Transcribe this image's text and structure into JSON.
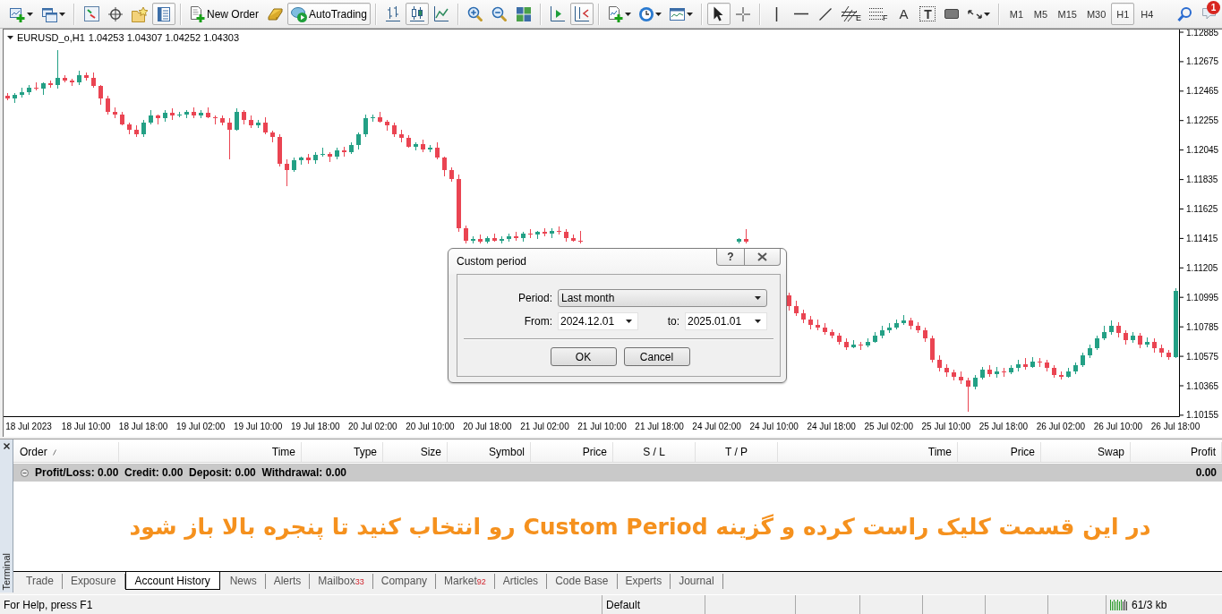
{
  "toolbar": [
    {
      "kind": "new-chart",
      "dropdown": true,
      "pressed": false
    },
    {
      "kind": "profiles",
      "dropdown": true,
      "pressed": false
    },
    {
      "kind": "separator"
    },
    {
      "kind": "market-watch",
      "pressed": false
    },
    {
      "kind": "data-window",
      "pressed": false
    },
    {
      "kind": "navigator",
      "pressed": false
    },
    {
      "kind": "terminal",
      "pressed": true
    },
    {
      "kind": "separator"
    },
    {
      "kind": "new-order",
      "label": "New Order",
      "pressed": false
    },
    {
      "kind": "editor",
      "pressed": false
    },
    {
      "kind": "autotrading",
      "label": "AutoTrading",
      "pressed": true
    },
    {
      "kind": "separator"
    },
    {
      "kind": "bars",
      "pressed": false
    },
    {
      "kind": "candles",
      "pressed": true
    },
    {
      "kind": "line",
      "pressed": false
    },
    {
      "kind": "separator"
    },
    {
      "kind": "zoom-in",
      "pressed": false
    },
    {
      "kind": "zoom-out",
      "pressed": false
    },
    {
      "kind": "tile",
      "pressed": false
    },
    {
      "kind": "separator"
    },
    {
      "kind": "chart-shift",
      "pressed": false
    },
    {
      "kind": "autoscroll",
      "pressed": true
    },
    {
      "kind": "separator"
    },
    {
      "kind": "indicators",
      "dropdown": true,
      "pressed": false
    },
    {
      "kind": "periods",
      "dropdown": true,
      "pressed": false
    },
    {
      "kind": "templates",
      "dropdown": true,
      "pressed": false
    },
    {
      "kind": "separator"
    },
    {
      "kind": "cursor",
      "pressed": true
    },
    {
      "kind": "crosshair",
      "pressed": false
    },
    {
      "kind": "separator"
    },
    {
      "kind": "vline",
      "pressed": false
    },
    {
      "kind": "hline",
      "pressed": false
    },
    {
      "kind": "trendline",
      "pressed": false
    },
    {
      "kind": "fibo-channel",
      "glyph": "E",
      "pressed": false
    },
    {
      "kind": "fibo-levels",
      "glyph": "F",
      "pressed": false
    },
    {
      "kind": "text-tool",
      "glyph": "A",
      "pressed": false
    },
    {
      "kind": "text-label",
      "glyph": "T",
      "pressed": false
    },
    {
      "kind": "rectangle",
      "pressed": false
    },
    {
      "kind": "arrows",
      "dropdown": true,
      "pressed": false
    },
    {
      "kind": "separator"
    },
    {
      "kind": "timeframe",
      "label": "M1",
      "pressed": false
    },
    {
      "kind": "timeframe",
      "label": "M5",
      "pressed": false
    },
    {
      "kind": "timeframe",
      "label": "M15",
      "pressed": false
    },
    {
      "kind": "timeframe",
      "label": "M30",
      "pressed": false
    },
    {
      "kind": "timeframe",
      "label": "H1",
      "pressed": true
    },
    {
      "kind": "timeframe",
      "label": "H4",
      "pressed": false
    },
    {
      "kind": "search",
      "pressed": false
    },
    {
      "kind": "chat",
      "badge": "1",
      "pressed": false
    }
  ],
  "chart": {
    "symbol": "EURUSD_o,H1",
    "quote": "1.04253 1.04307 1.04252 1.04303",
    "chart_data": {
      "type": "candlestick",
      "ylim": [
        1.10148,
        1.12904
      ],
      "yticks": [
        1.12885,
        1.12675,
        1.12465,
        1.12255,
        1.12045,
        1.11835,
        1.11625,
        1.11415,
        1.11205,
        1.10995,
        1.10785,
        1.10575,
        1.10365,
        1.10155
      ],
      "categories": [
        null,
        null,
        null,
        "18 Jul 2023",
        null,
        null,
        null,
        null,
        null,
        null,
        null,
        "18 Jul 10:00",
        null,
        null,
        null,
        null,
        null,
        null,
        null,
        "18 Jul 18:00",
        null,
        null,
        null,
        null,
        null,
        null,
        null,
        "19 Jul 02:00",
        null,
        null,
        null,
        null,
        null,
        null,
        null,
        "19 Jul 10:00",
        null,
        null,
        null,
        null,
        null,
        null,
        null,
        "19 Jul 18:00",
        null,
        null,
        null,
        null,
        null,
        null,
        null,
        "20 Jul 02:00",
        null,
        null,
        null,
        null,
        null,
        null,
        null,
        "20 Jul 10:00",
        null,
        null,
        null,
        null,
        null,
        null,
        null,
        "20 Jul 18:00",
        null,
        null,
        null,
        null,
        null,
        null,
        null,
        "21 Jul 02:00",
        null,
        null,
        null,
        null,
        null,
        null,
        null,
        "21 Jul 10:00",
        null,
        null,
        null,
        null,
        null,
        null,
        null,
        "21 Jul 18:00",
        null,
        null,
        null,
        null,
        null,
        null,
        null,
        "24 Jul 02:00",
        null,
        null,
        null,
        null,
        null,
        null,
        null,
        "24 Jul 10:00",
        null,
        null,
        null,
        null,
        null,
        null,
        null,
        "24 Jul 18:00",
        null,
        null,
        null,
        null,
        null,
        null,
        null,
        "25 Jul 02:00",
        null,
        null,
        null,
        null,
        null,
        null,
        null,
        "25 Jul 10:00",
        null,
        null,
        null,
        null,
        null,
        null,
        null,
        "25 Jul 18:00",
        null,
        null,
        null,
        null,
        null,
        null,
        null,
        "26 Jul 02:00",
        null,
        null,
        null,
        null,
        null,
        null,
        null,
        "26 Jul 10:00",
        null,
        null,
        null,
        null,
        null,
        null,
        null,
        "26 Jul 18:00"
      ],
      "ohlc": [
        [
          1.1243,
          1.1245,
          1.124,
          1.1241
        ],
        [
          1.1241,
          1.1245,
          1.1238,
          1.1244
        ],
        [
          1.1244,
          1.1249,
          1.1242,
          1.1246
        ],
        [
          1.1246,
          1.1251,
          1.1244,
          1.1249
        ],
        [
          1.1249,
          1.1253,
          1.1247,
          1.1248
        ],
        [
          1.1248,
          1.1253,
          1.1244,
          1.1252
        ],
        [
          1.1252,
          1.1254,
          1.1249,
          1.1251
        ],
        [
          1.1251,
          1.1276,
          1.1248,
          1.1256
        ],
        [
          1.1256,
          1.1258,
          1.1253,
          1.1254
        ],
        [
          1.1254,
          1.1255,
          1.125,
          1.1253
        ],
        [
          1.1253,
          1.1261,
          1.1251,
          1.1258
        ],
        [
          1.1258,
          1.126,
          1.1254,
          1.1256
        ],
        [
          1.1256,
          1.126,
          1.1249,
          1.125
        ],
        [
          1.125,
          1.1251,
          1.1237,
          1.1241
        ],
        [
          1.1241,
          1.1243,
          1.123,
          1.1232
        ],
        [
          1.1232,
          1.1235,
          1.1227,
          1.123
        ],
        [
          1.123,
          1.1232,
          1.1222,
          1.1223
        ],
        [
          1.1223,
          1.1224,
          1.1216,
          1.1219
        ],
        [
          1.1219,
          1.1222,
          1.1214,
          1.1216
        ],
        [
          1.1216,
          1.1226,
          1.1214,
          1.1224
        ],
        [
          1.1224,
          1.1233,
          1.1223,
          1.1229
        ],
        [
          1.1229,
          1.123,
          1.1223,
          1.1227
        ],
        [
          1.1227,
          1.1233,
          1.1225,
          1.1231
        ],
        [
          1.1231,
          1.1234,
          1.1226,
          1.1229
        ],
        [
          1.1229,
          1.1232,
          1.1228,
          1.123
        ],
        [
          1.123,
          1.1233,
          1.1227,
          1.1232
        ],
        [
          1.1232,
          1.1235,
          1.1227,
          1.1229
        ],
        [
          1.1229,
          1.1233,
          1.1227,
          1.1231
        ],
        [
          1.1231,
          1.1235,
          1.1227,
          1.1228
        ],
        [
          1.1228,
          1.1229,
          1.1223,
          1.1227
        ],
        [
          1.1227,
          1.1229,
          1.1222,
          1.1224
        ],
        [
          1.1224,
          1.1227,
          1.1198,
          1.1219
        ],
        [
          1.1219,
          1.1234,
          1.1218,
          1.1232
        ],
        [
          1.1232,
          1.1233,
          1.1223,
          1.1226
        ],
        [
          1.1226,
          1.1229,
          1.122,
          1.1222
        ],
        [
          1.1222,
          1.1226,
          1.122,
          1.1224
        ],
        [
          1.1224,
          1.1228,
          1.1216,
          1.1217
        ],
        [
          1.1217,
          1.1218,
          1.121,
          1.1214
        ],
        [
          1.1214,
          1.1216,
          1.1193,
          1.1195
        ],
        [
          1.1195,
          1.1198,
          1.1179,
          1.119
        ],
        [
          1.119,
          1.1199,
          1.1189,
          1.1197
        ],
        [
          1.1197,
          1.12,
          1.1194,
          1.1199
        ],
        [
          1.1199,
          1.1202,
          1.1195,
          1.1197
        ],
        [
          1.1197,
          1.1203,
          1.1195,
          1.1201
        ],
        [
          1.1201,
          1.1206,
          1.12,
          1.1202
        ],
        [
          1.1202,
          1.1203,
          1.1196,
          1.12
        ],
        [
          1.12,
          1.1206,
          1.1198,
          1.1204
        ],
        [
          1.1204,
          1.1207,
          1.12,
          1.1203
        ],
        [
          1.1203,
          1.121,
          1.1202,
          1.1208
        ],
        [
          1.1208,
          1.1217,
          1.1205,
          1.1216
        ],
        [
          1.1216,
          1.123,
          1.1214,
          1.1227
        ],
        [
          1.1227,
          1.123,
          1.1225,
          1.1228
        ],
        [
          1.1228,
          1.1232,
          1.1224,
          1.1225
        ],
        [
          1.1225,
          1.1226,
          1.1218,
          1.1222
        ],
        [
          1.1222,
          1.1224,
          1.1214,
          1.1216
        ],
        [
          1.1216,
          1.1219,
          1.121,
          1.1213
        ],
        [
          1.1213,
          1.1215,
          1.1206,
          1.1207
        ],
        [
          1.1207,
          1.121,
          1.1204,
          1.1209
        ],
        [
          1.1209,
          1.1212,
          1.1203,
          1.1205
        ],
        [
          1.1205,
          1.1208,
          1.1203,
          1.1206
        ],
        [
          1.1206,
          1.121,
          1.1198,
          1.1199
        ],
        [
          1.1199,
          1.12,
          1.1186,
          1.119
        ],
        [
          1.119,
          1.1192,
          1.1182,
          1.1184
        ],
        [
          1.1184,
          1.1187,
          1.1146,
          1.1149
        ],
        [
          1.1149,
          1.1151,
          1.1138,
          1.114
        ],
        [
          1.114,
          1.1143,
          1.1138,
          1.1141
        ],
        [
          1.1141,
          1.1144,
          1.1138,
          1.1139
        ],
        [
          1.1139,
          1.1143,
          1.1138,
          1.1142
        ],
        [
          1.1142,
          1.1145,
          1.1139,
          1.114
        ],
        [
          1.114,
          1.1143,
          1.1138,
          1.1141
        ],
        [
          1.1141,
          1.1145,
          1.1139,
          1.1143
        ],
        [
          1.1143,
          1.1146,
          1.114,
          1.1142
        ],
        [
          1.1142,
          1.1146,
          1.1139,
          1.1145
        ],
        [
          1.1145,
          1.1148,
          1.1142,
          1.1144
        ],
        [
          1.1144,
          1.1147,
          1.1141,
          1.1146
        ],
        [
          1.1146,
          1.1149,
          1.1143,
          1.1145
        ],
        [
          1.1145,
          1.1149,
          1.1142,
          1.1147
        ],
        [
          1.1147,
          1.115,
          1.1144,
          1.1146
        ],
        [
          1.1146,
          1.1148,
          1.1139,
          1.1142
        ],
        [
          1.1142,
          1.1144,
          1.1139,
          1.114
        ],
        [
          1.114,
          1.1147,
          1.1138,
          1.1139
        ],
        null,
        null,
        null,
        null,
        null,
        null,
        null,
        null,
        null,
        null,
        null,
        null,
        null,
        null,
        null,
        null,
        null,
        null,
        null,
        null,
        null,
        [
          1.1139,
          1.1142,
          1.1138,
          1.1141
        ],
        [
          1.1141,
          1.1148,
          1.1138,
          1.1139
        ],
        null,
        null,
        null,
        null,
        null,
        [
          1.1101,
          1.1103,
          1.109,
          1.1093
        ],
        [
          1.1093,
          1.1097,
          1.1086,
          1.1088
        ],
        [
          1.1088,
          1.1091,
          1.1081,
          1.1084
        ],
        [
          1.1084,
          1.1086,
          1.1077,
          1.108
        ],
        [
          1.108,
          1.1084,
          1.1076,
          1.1078
        ],
        [
          1.1078,
          1.1081,
          1.1073,
          1.1075
        ],
        [
          1.1075,
          1.1077,
          1.107,
          1.1072
        ],
        [
          1.1072,
          1.1074,
          1.1066,
          1.1068
        ],
        [
          1.1068,
          1.107,
          1.1062,
          1.1064
        ],
        [
          1.1064,
          1.1069,
          1.1063,
          1.1066
        ],
        [
          1.1066,
          1.1068,
          1.1062,
          1.1065
        ],
        [
          1.1065,
          1.107,
          1.1064,
          1.1068
        ],
        [
          1.1068,
          1.1075,
          1.1067,
          1.1072
        ],
        [
          1.1072,
          1.1079,
          1.107,
          1.1076
        ],
        [
          1.1076,
          1.1081,
          1.1074,
          1.1078
        ],
        [
          1.1078,
          1.1084,
          1.1077,
          1.1081
        ],
        [
          1.1081,
          1.1087,
          1.108,
          1.1083
        ],
        [
          1.1083,
          1.1085,
          1.1077,
          1.1079
        ],
        [
          1.1079,
          1.1082,
          1.1074,
          1.1076
        ],
        [
          1.1076,
          1.1078,
          1.1068,
          1.107
        ],
        [
          1.107,
          1.1072,
          1.1053,
          1.1055
        ],
        [
          1.1055,
          1.1058,
          1.1047,
          1.1049
        ],
        [
          1.1049,
          1.1052,
          1.1043,
          1.1046
        ],
        [
          1.1046,
          1.1048,
          1.104,
          1.1043
        ],
        [
          1.1043,
          1.1047,
          1.1038,
          1.104
        ],
        [
          1.104,
          1.1042,
          1.1018,
          1.1036
        ],
        [
          1.1036,
          1.1044,
          1.1034,
          1.1042
        ],
        [
          1.1042,
          1.105,
          1.1041,
          1.1048
        ],
        [
          1.1048,
          1.1051,
          1.1043,
          1.1045
        ],
        [
          1.1045,
          1.105,
          1.1042,
          1.1047
        ],
        [
          1.1047,
          1.1049,
          1.1043,
          1.1046
        ],
        [
          1.1046,
          1.1051,
          1.1045,
          1.1049
        ],
        [
          1.1049,
          1.1055,
          1.1047,
          1.1052
        ],
        [
          1.1052,
          1.1056,
          1.1048,
          1.105
        ],
        [
          1.105,
          1.1057,
          1.1049,
          1.1054
        ],
        [
          1.1054,
          1.1056,
          1.105,
          1.1053
        ],
        [
          1.1053,
          1.1055,
          1.1047,
          1.1049
        ],
        [
          1.1049,
          1.1051,
          1.1042,
          1.1044
        ],
        [
          1.1044,
          1.1047,
          1.1041,
          1.1043
        ],
        [
          1.1043,
          1.1049,
          1.1042,
          1.1047
        ],
        [
          1.1047,
          1.1053,
          1.1045,
          1.1051
        ],
        [
          1.1051,
          1.106,
          1.105,
          1.1058
        ],
        [
          1.1058,
          1.1066,
          1.1056,
          1.1063
        ],
        [
          1.1063,
          1.1072,
          1.1062,
          1.107
        ],
        [
          1.107,
          1.1079,
          1.1069,
          1.1075
        ],
        [
          1.1075,
          1.1083,
          1.1073,
          1.1079
        ],
        [
          1.1079,
          1.1082,
          1.1071,
          1.1074
        ],
        [
          1.1074,
          1.1076,
          1.1066,
          1.1069
        ],
        [
          1.1069,
          1.1075,
          1.1067,
          1.1072
        ],
        [
          1.1072,
          1.1074,
          1.1063,
          1.1066
        ],
        [
          1.1066,
          1.1071,
          1.1064,
          1.1068
        ],
        [
          1.1068,
          1.107,
          1.106,
          1.1063
        ],
        [
          1.1063,
          1.1066,
          1.1057,
          1.106
        ],
        [
          1.106,
          1.1062,
          1.1055,
          1.1057
        ],
        [
          1.1057,
          1.1106,
          1.1056,
          1.1104
        ]
      ]
    }
  },
  "dialog": {
    "title": "Custom period",
    "help": "?",
    "period": {
      "label": "Period:",
      "value": "Last month"
    },
    "from": {
      "label": "From:",
      "value": "2024.12.01"
    },
    "to": {
      "label": "to:",
      "value": "2025.01.01"
    },
    "buttons": [
      "OK",
      "Cancel"
    ]
  },
  "terminal": {
    "title": "Terminal",
    "columns": [
      {
        "label": "Order",
        "sorted": true
      },
      {
        "label": "Time",
        "sorted": false
      },
      {
        "label": "Type",
        "sorted": false
      },
      {
        "label": "Size",
        "sorted": false
      },
      {
        "label": "Symbol",
        "sorted": false
      },
      {
        "label": "Price",
        "sorted": false
      },
      {
        "label": "S / L",
        "sorted": false
      },
      {
        "label": "T / P",
        "sorted": false
      },
      {
        "label": "Time",
        "sorted": false
      },
      {
        "label": "Price",
        "sorted": false
      },
      {
        "label": "Swap",
        "sorted": false
      },
      {
        "label": "Profit",
        "sorted": false
      }
    ],
    "summary": {
      "text": "Profit/Loss: 0.00  Credit: 0.00  Deposit: 0.00  Withdrawal: 0.00",
      "profit": "0.00"
    },
    "annotation": "در این قسمت کلیک راست کرده و گزینه Custom Period رو انتخاب کنید تا پنجره بالا باز شود",
    "tabs": [
      {
        "label": "Trade",
        "selected": false
      },
      {
        "label": "Exposure",
        "selected": false
      },
      {
        "label": "Account History",
        "selected": true
      },
      {
        "label": "News",
        "selected": false
      },
      {
        "label": "Alerts",
        "selected": false
      },
      {
        "label": "Mailbox",
        "count": "33",
        "selected": false
      },
      {
        "label": "Company",
        "selected": false
      },
      {
        "label": "Market",
        "count": "92",
        "selected": false
      },
      {
        "label": "Articles",
        "selected": false
      },
      {
        "label": "Code Base",
        "selected": false
      },
      {
        "label": "Experts",
        "selected": false
      },
      {
        "label": "Journal",
        "selected": false
      }
    ]
  },
  "status_bar": {
    "help": "For Help, press F1",
    "profile": "Default",
    "traffic": "61/3 kb"
  }
}
